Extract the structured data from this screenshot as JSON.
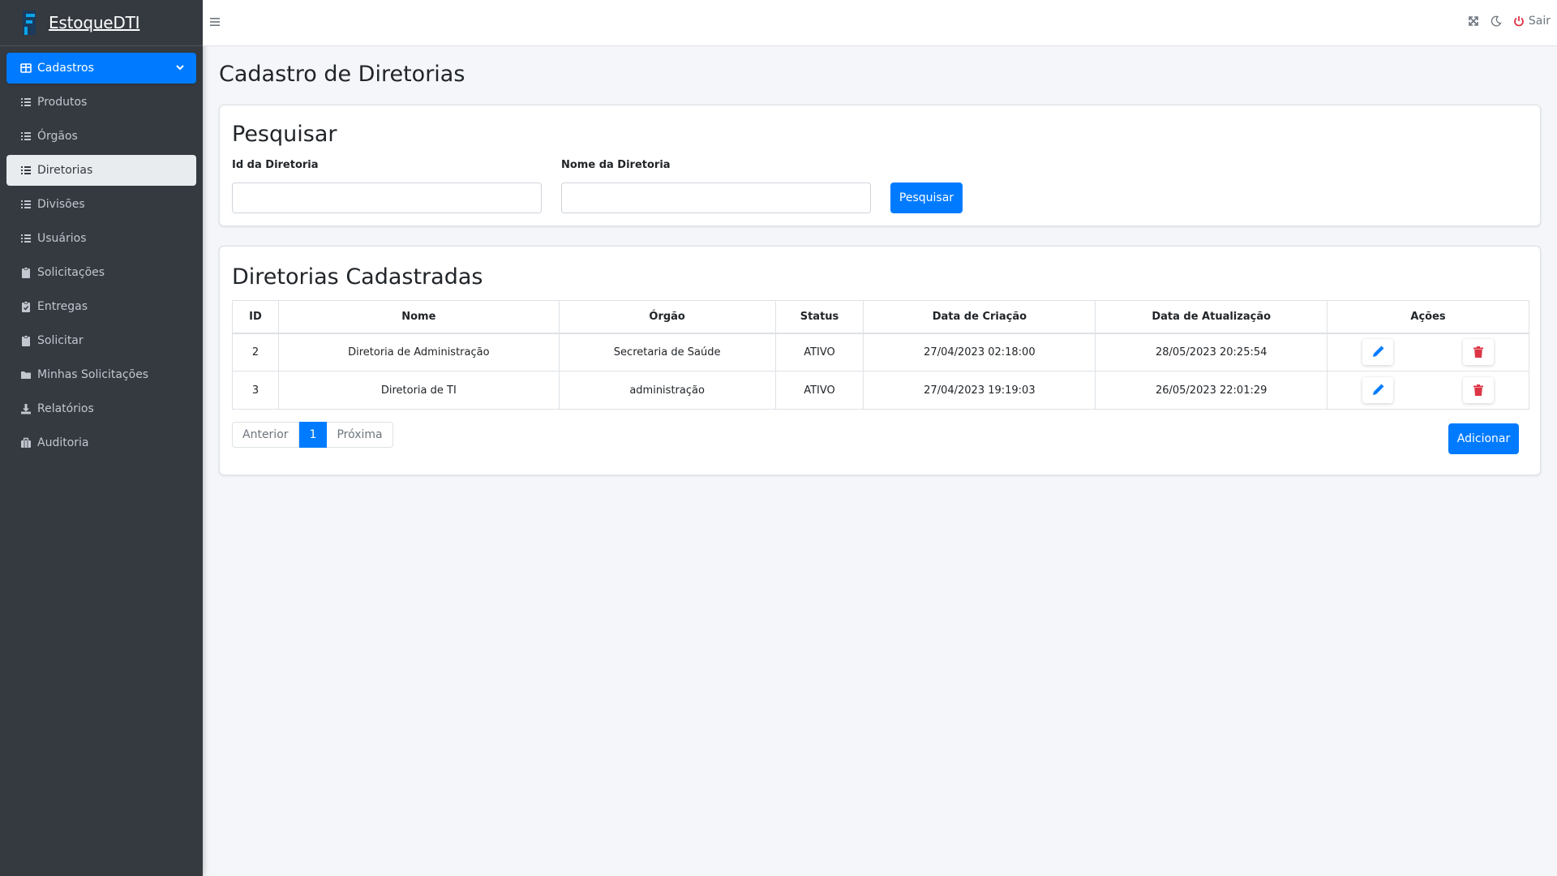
{
  "brand": {
    "title": "EstoqueDTI"
  },
  "sidebar": {
    "items": [
      {
        "label": "Cadastros",
        "icon": "table-icon"
      },
      {
        "label": "Produtos",
        "icon": "list-icon"
      },
      {
        "label": "Órgãos",
        "icon": "list-icon"
      },
      {
        "label": "Diretorias",
        "icon": "list-icon"
      },
      {
        "label": "Divisões",
        "icon": "list-icon"
      },
      {
        "label": "Usuários",
        "icon": "list-icon"
      },
      {
        "label": "Solicitações",
        "icon": "clipboard-icon"
      },
      {
        "label": "Entregas",
        "icon": "clipboard-check-icon"
      },
      {
        "label": "Solicitar",
        "icon": "clipboard-icon"
      },
      {
        "label": "Minhas Solicitações",
        "icon": "folder-icon"
      },
      {
        "label": "Relatórios",
        "icon": "download-icon"
      },
      {
        "label": "Auditoria",
        "icon": "briefcase-icon"
      }
    ]
  },
  "topbar": {
    "logout_label": "Sair"
  },
  "page": {
    "title": "Cadastro de Diretorias"
  },
  "search": {
    "title": "Pesquisar",
    "id_label": "Id da Diretoria",
    "id_value": "",
    "name_label": "Nome da Diretoria",
    "name_value": "",
    "button_label": "Pesquisar"
  },
  "list": {
    "title": "Diretorias Cadastradas",
    "columns": [
      "ID",
      "Nome",
      "Órgão",
      "Status",
      "Data de Criação",
      "Data de Atualização",
      "Ações"
    ],
    "rows": [
      {
        "id": "2",
        "nome": "Diretoria de Administração",
        "orgao": "Secretaria de Saúde",
        "status": "ATIVO",
        "criacao": "27/04/2023 02:18:00",
        "atualizacao": "28/05/2023 20:25:54"
      },
      {
        "id": "3",
        "nome": "Diretoria de TI",
        "orgao": "administração",
        "status": "ATIVO",
        "criacao": "27/04/2023 19:19:03",
        "atualizacao": "26/05/2023 22:01:29"
      }
    ],
    "pagination": {
      "prev": "Anterior",
      "current": "1",
      "next": "Próxima"
    },
    "add_label": "Adicionar"
  },
  "colors": {
    "primary": "#007bff",
    "sidebar": "#343a40",
    "danger": "#dc3545",
    "logout": "#dc3545"
  }
}
